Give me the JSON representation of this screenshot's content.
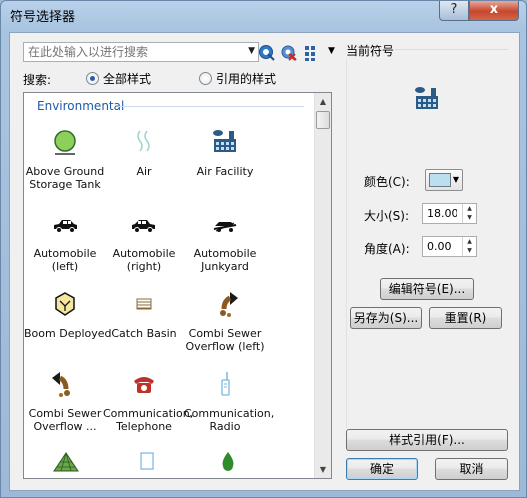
{
  "window": {
    "title": "符号选择器",
    "help_glyph": "?",
    "close_glyph": "x"
  },
  "search": {
    "placeholder": "在此处输入以进行搜索",
    "label": "搜索:",
    "option_all": "全部样式",
    "option_referenced": "引用的样式",
    "selected": "all"
  },
  "toolbar": {
    "search_icon": "magnifier-icon",
    "clear_icon": "clear-search-icon",
    "view_icon": "grid-view-icon"
  },
  "category": "Environmental",
  "symbols": [
    {
      "label1": "Above Ground",
      "label2": "Storage Tank",
      "icon": "storage-tank-icon"
    },
    {
      "label1": "Air",
      "label2": "",
      "icon": "air-icon"
    },
    {
      "label1": "Air Facility",
      "label2": "",
      "icon": "air-facility-icon",
      "selected": true
    },
    {
      "label1": "Automobile",
      "label2": "(left)",
      "icon": "car-left-icon"
    },
    {
      "label1": "Automobile",
      "label2": "(right)",
      "icon": "car-right-icon"
    },
    {
      "label1": "Automobile",
      "label2": "Junkyard",
      "icon": "car-junkyard-icon"
    },
    {
      "label1": "Boom Deployed",
      "label2": "",
      "icon": "boom-icon"
    },
    {
      "label1": "Catch Basin",
      "label2": "",
      "icon": "catch-basin-icon"
    },
    {
      "label1": "Combi Sewer",
      "label2": "Overflow (left)",
      "icon": "sewer-left-icon"
    },
    {
      "label1": "Combi Sewer",
      "label2": "Overflow ...",
      "icon": "sewer-right-icon"
    },
    {
      "label1": "Communication,",
      "label2": "Telephone",
      "icon": "telephone-icon"
    },
    {
      "label1": "Communication,",
      "label2": "Radio",
      "icon": "radio-icon"
    }
  ],
  "current": {
    "title": "当前符号",
    "color_label": "颜色(C):",
    "color_value": "#bcdff0",
    "size_label": "大小(S):",
    "size_value": "18.00",
    "angle_label": "角度(A):",
    "angle_value": "0.00"
  },
  "buttons": {
    "edit": "编辑符号(E)...",
    "save_as": "另存为(S)...",
    "reset": "重置(R)",
    "style_refs": "样式引用(F)...",
    "ok": "确定",
    "cancel": "取消"
  }
}
